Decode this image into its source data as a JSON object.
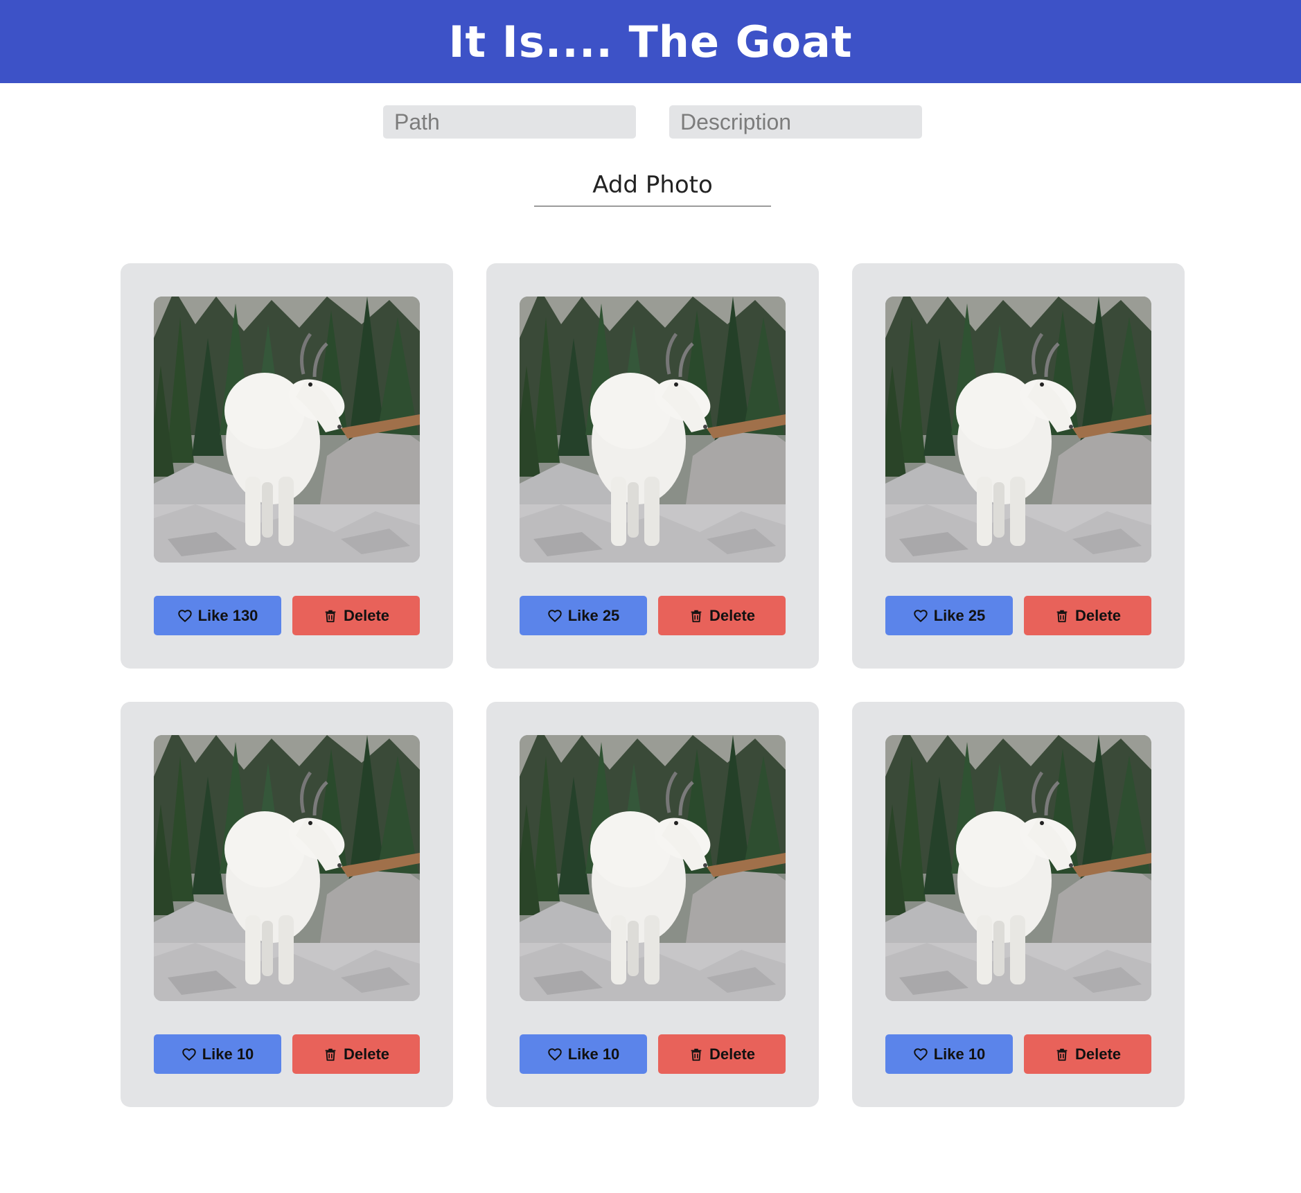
{
  "header": {
    "title": "It Is.... The Goat"
  },
  "form": {
    "path_placeholder": "Path",
    "description_placeholder": "Description",
    "add_label": "Add Photo"
  },
  "colors": {
    "header_bg": "#3d52c7",
    "like_button": "#5b84ea",
    "delete_button": "#e8625a",
    "card_bg": "#e3e4e6"
  },
  "photos": [
    {
      "like_label": "Like 130",
      "delete_label": "Delete",
      "like_icon": "heart-icon",
      "delete_icon": "trash-icon"
    },
    {
      "like_label": "Like 25",
      "delete_label": "Delete",
      "like_icon": "heart-icon",
      "delete_icon": "trash-icon"
    },
    {
      "like_label": "Like 25",
      "delete_label": "Delete",
      "like_icon": "heart-icon",
      "delete_icon": "trash-icon"
    },
    {
      "like_label": "Like 10",
      "delete_label": "Delete",
      "like_icon": "heart-icon",
      "delete_icon": "trash-icon"
    },
    {
      "like_label": "Like 10",
      "delete_label": "Delete",
      "like_icon": "heart-icon",
      "delete_icon": "trash-icon"
    },
    {
      "like_label": "Like 10",
      "delete_label": "Delete",
      "like_icon": "heart-icon",
      "delete_icon": "trash-icon"
    }
  ]
}
